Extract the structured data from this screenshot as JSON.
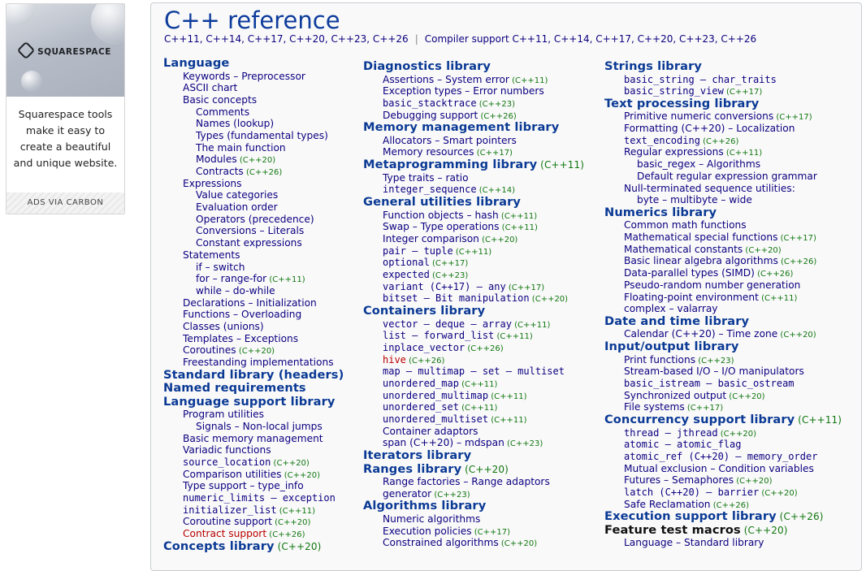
{
  "ad": {
    "logo": "SQUARESPACE",
    "text": "Squarespace tools make it easy to create a beautiful and unique website.",
    "via": "ADS VIA CARBON"
  },
  "page": {
    "title": "C++ reference",
    "versions": "C++11, C++14, C++17, C++20, C++23, C++26",
    "compiler_support": "Compiler support C++11, C++14, C++17, C++20, C++23, C++26"
  },
  "columns": [
    [
      {
        "k": "h",
        "t": "Language"
      },
      {
        "k": "i",
        "l": 1,
        "t": "Keywords – Preprocessor"
      },
      {
        "k": "i",
        "l": 1,
        "t": "ASCII chart"
      },
      {
        "k": "i",
        "l": 1,
        "t": "Basic concepts"
      },
      {
        "k": "i",
        "l": 2,
        "t": "Comments"
      },
      {
        "k": "i",
        "l": 2,
        "t": "Names (lookup)"
      },
      {
        "k": "i",
        "l": 2,
        "t": "Types (fundamental types)"
      },
      {
        "k": "i",
        "l": 2,
        "t": "The main function"
      },
      {
        "k": "i",
        "l": 2,
        "t": "Modules",
        "v": "(C++20)"
      },
      {
        "k": "i",
        "l": 2,
        "t": "Contracts",
        "v": "(C++26)"
      },
      {
        "k": "i",
        "l": 1,
        "t": "Expressions"
      },
      {
        "k": "i",
        "l": 2,
        "t": "Value categories"
      },
      {
        "k": "i",
        "l": 2,
        "t": "Evaluation order"
      },
      {
        "k": "i",
        "l": 2,
        "t": "Operators (precedence)"
      },
      {
        "k": "i",
        "l": 2,
        "t": "Conversions – Literals"
      },
      {
        "k": "i",
        "l": 2,
        "t": "Constant expressions"
      },
      {
        "k": "i",
        "l": 1,
        "t": "Statements"
      },
      {
        "k": "i",
        "l": 2,
        "t": "if – switch"
      },
      {
        "k": "i",
        "l": 2,
        "t": "for – range-for",
        "v": "(C++11)"
      },
      {
        "k": "i",
        "l": 2,
        "t": "while – do-while"
      },
      {
        "k": "i",
        "l": 1,
        "t": "Declarations – Initialization"
      },
      {
        "k": "i",
        "l": 1,
        "t": "Functions – Overloading"
      },
      {
        "k": "i",
        "l": 1,
        "t": "Classes (unions)"
      },
      {
        "k": "i",
        "l": 1,
        "t": "Templates – Exceptions"
      },
      {
        "k": "i",
        "l": 1,
        "t": "Coroutines",
        "v": "(C++20)"
      },
      {
        "k": "i",
        "l": 1,
        "t": "Freestanding implementations"
      },
      {
        "k": "h",
        "t": "Standard library (headers)"
      },
      {
        "k": "h",
        "t": "Named requirements"
      },
      {
        "k": "h",
        "t": "Language support library"
      },
      {
        "k": "i",
        "l": 1,
        "t": "Program utilities"
      },
      {
        "k": "i",
        "l": 2,
        "t": "Signals – Non-local jumps"
      },
      {
        "k": "i",
        "l": 1,
        "t": "Basic memory management"
      },
      {
        "k": "i",
        "l": 1,
        "t": "Variadic functions"
      },
      {
        "k": "i",
        "l": 1,
        "t": "source_location",
        "v": "(C++20)",
        "m": true
      },
      {
        "k": "i",
        "l": 1,
        "t": "Comparison utilities",
        "v": "(C++20)"
      },
      {
        "k": "i",
        "l": 1,
        "t": "Type support – type_info"
      },
      {
        "k": "i",
        "l": 1,
        "t": "numeric_limits – exception",
        "m": true
      },
      {
        "k": "i",
        "l": 1,
        "t": "initializer_list",
        "v": "(C++11)",
        "m": true
      },
      {
        "k": "i",
        "l": 1,
        "t": "Coroutine support",
        "v": "(C++20)"
      },
      {
        "k": "i",
        "l": 1,
        "t": "Contract support",
        "v": "(C++26)",
        "red": true
      },
      {
        "k": "h",
        "t": "Concepts library",
        "v": "(C++20)"
      }
    ],
    [
      {
        "k": "h",
        "t": "Diagnostics library"
      },
      {
        "k": "i",
        "l": 1,
        "t": "Assertions – System error",
        "v": "(C++11)"
      },
      {
        "k": "i",
        "l": 1,
        "t": "Exception types – Error numbers"
      },
      {
        "k": "i",
        "l": 1,
        "t": "basic_stacktrace",
        "v": "(C++23)",
        "m": true
      },
      {
        "k": "i",
        "l": 1,
        "t": "Debugging support",
        "v": "(C++26)"
      },
      {
        "k": "h",
        "t": "Memory management library"
      },
      {
        "k": "i",
        "l": 1,
        "t": "Allocators – Smart pointers"
      },
      {
        "k": "i",
        "l": 1,
        "t": "Memory resources",
        "v": "(C++17)"
      },
      {
        "k": "h",
        "t": "Metaprogramming library",
        "v": "(C++11)"
      },
      {
        "k": "i",
        "l": 1,
        "t": "Type traits – ratio"
      },
      {
        "k": "i",
        "l": 1,
        "t": "integer_sequence",
        "v": "(C++14)",
        "m": true
      },
      {
        "k": "h",
        "t": "General utilities library"
      },
      {
        "k": "i",
        "l": 1,
        "t": "Function objects – hash",
        "v": "(C++11)"
      },
      {
        "k": "i",
        "l": 1,
        "t": "Swap – Type operations",
        "v": "(C++11)"
      },
      {
        "k": "i",
        "l": 1,
        "t": "Integer comparison",
        "v": "(C++20)"
      },
      {
        "k": "i",
        "l": 1,
        "t": "pair – tuple",
        "v": "(C++11)",
        "m": true
      },
      {
        "k": "i",
        "l": 1,
        "t": "optional",
        "v": "(C++17)",
        "m": true
      },
      {
        "k": "i",
        "l": 1,
        "t": "expected",
        "v": "(C++23)",
        "m": true
      },
      {
        "k": "i",
        "l": 1,
        "t": "variant (C++17) – any",
        "v": "(C++17)",
        "m": true
      },
      {
        "k": "i",
        "l": 1,
        "t": "bitset – Bit manipulation",
        "v": "(C++20)",
        "m": true
      },
      {
        "k": "h",
        "t": "Containers library"
      },
      {
        "k": "i",
        "l": 1,
        "t": "vector – deque – array",
        "v": "(C++11)",
        "m": true
      },
      {
        "k": "i",
        "l": 1,
        "t": "list – forward_list",
        "v": "(C++11)",
        "m": true
      },
      {
        "k": "i",
        "l": 1,
        "t": "inplace_vector",
        "v": "(C++26)",
        "m": true
      },
      {
        "k": "i",
        "l": 1,
        "t": "hive",
        "v": "(C++26)",
        "m": true,
        "red": true
      },
      {
        "k": "i",
        "l": 1,
        "t": "map – multimap – set – multiset",
        "m": true
      },
      {
        "k": "i",
        "l": 1,
        "t": "unordered_map",
        "v": "(C++11)",
        "m": true
      },
      {
        "k": "i",
        "l": 1,
        "t": "unordered_multimap",
        "v": "(C++11)",
        "m": true
      },
      {
        "k": "i",
        "l": 1,
        "t": "unordered_set",
        "v": "(C++11)",
        "m": true
      },
      {
        "k": "i",
        "l": 1,
        "t": "unordered_multiset",
        "v": "(C++11)",
        "m": true
      },
      {
        "k": "i",
        "l": 1,
        "t": "Container adaptors"
      },
      {
        "k": "i",
        "l": 1,
        "t": "span (C++20) – mdspan",
        "v": "(C++23)"
      },
      {
        "k": "h",
        "t": "Iterators library"
      },
      {
        "k": "h",
        "t": "Ranges library",
        "v": "(C++20)"
      },
      {
        "k": "i",
        "l": 1,
        "t": "Range factories – Range adaptors"
      },
      {
        "k": "i",
        "l": 1,
        "t": "generator",
        "v": "(C++23)"
      },
      {
        "k": "h",
        "t": "Algorithms library"
      },
      {
        "k": "i",
        "l": 1,
        "t": "Numeric algorithms"
      },
      {
        "k": "i",
        "l": 1,
        "t": "Execution policies",
        "v": "(C++17)"
      },
      {
        "k": "i",
        "l": 1,
        "t": "Constrained algorithms",
        "v": "(C++20)"
      }
    ],
    [
      {
        "k": "h",
        "t": "Strings library"
      },
      {
        "k": "i",
        "l": 1,
        "t": "basic_string – char_traits",
        "m": true
      },
      {
        "k": "i",
        "l": 1,
        "t": "basic_string_view",
        "v": "(C++17)",
        "m": true
      },
      {
        "k": "h",
        "t": "Text processing library"
      },
      {
        "k": "i",
        "l": 1,
        "t": "Primitive numeric conversions",
        "v": "(C++17)"
      },
      {
        "k": "i",
        "l": 1,
        "t": "Formatting (C++20) – Localization"
      },
      {
        "k": "i",
        "l": 1,
        "t": "text_encoding",
        "v": "(C++26)",
        "m": true
      },
      {
        "k": "i",
        "l": 1,
        "t": "Regular expressions",
        "v": "(C++11)"
      },
      {
        "k": "i",
        "l": 2,
        "t": "basic_regex – Algorithms"
      },
      {
        "k": "i",
        "l": 2,
        "t": "Default regular expression grammar"
      },
      {
        "k": "i",
        "l": 1,
        "t": "Null-terminated sequence utilities:"
      },
      {
        "k": "i",
        "l": 2,
        "t": "byte – multibyte – wide"
      },
      {
        "k": "h",
        "t": "Numerics library"
      },
      {
        "k": "i",
        "l": 1,
        "t": "Common math functions"
      },
      {
        "k": "i",
        "l": 1,
        "t": "Mathematical special functions",
        "v": "(C++17)"
      },
      {
        "k": "i",
        "l": 1,
        "t": "Mathematical constants",
        "v": "(C++20)"
      },
      {
        "k": "i",
        "l": 1,
        "t": "Basic linear algebra algorithms",
        "v": "(C++26)"
      },
      {
        "k": "i",
        "l": 1,
        "t": "Data-parallel types (SIMD)",
        "v": "(C++26)"
      },
      {
        "k": "i",
        "l": 1,
        "t": "Pseudo-random number generation"
      },
      {
        "k": "i",
        "l": 1,
        "t": "Floating-point environment",
        "v": "(C++11)"
      },
      {
        "k": "i",
        "l": 1,
        "t": "complex – valarray"
      },
      {
        "k": "h",
        "t": "Date and time library"
      },
      {
        "k": "i",
        "l": 1,
        "t": "Calendar (C++20) – Time zone",
        "v": "(C++20)"
      },
      {
        "k": "h",
        "t": "Input/output library"
      },
      {
        "k": "i",
        "l": 1,
        "t": "Print functions",
        "v": "(C++23)"
      },
      {
        "k": "i",
        "l": 1,
        "t": "Stream-based I/O – I/O manipulators"
      },
      {
        "k": "i",
        "l": 1,
        "t": "basic_istream – basic_ostream",
        "m": true
      },
      {
        "k": "i",
        "l": 1,
        "t": "Synchronized output",
        "v": "(C++20)"
      },
      {
        "k": "i",
        "l": 1,
        "t": "File systems",
        "v": "(C++17)"
      },
      {
        "k": "h",
        "t": "Concurrency support library",
        "v": "(C++11)"
      },
      {
        "k": "i",
        "l": 1,
        "t": "thread – jthread",
        "v": "(C++20)",
        "m": true
      },
      {
        "k": "i",
        "l": 1,
        "t": "atomic – atomic_flag",
        "m": true
      },
      {
        "k": "i",
        "l": 1,
        "t": "atomic_ref (C++20) – memory_order",
        "m": true
      },
      {
        "k": "i",
        "l": 1,
        "t": "Mutual exclusion – Condition variables"
      },
      {
        "k": "i",
        "l": 1,
        "t": "Futures – Semaphores",
        "v": "(C++20)"
      },
      {
        "k": "i",
        "l": 1,
        "t": "latch (C++20) – barrier",
        "v": "(C++20)",
        "m": true
      },
      {
        "k": "i",
        "l": 1,
        "t": "Safe Reclamation",
        "v": "(C++26)"
      },
      {
        "k": "h",
        "t": "Execution support library",
        "v": "(C++26)"
      },
      {
        "k": "h",
        "t": "Feature test macros",
        "v": "(C++20)",
        "black": true
      },
      {
        "k": "i",
        "l": 1,
        "t": "Language – Standard library"
      }
    ]
  ]
}
